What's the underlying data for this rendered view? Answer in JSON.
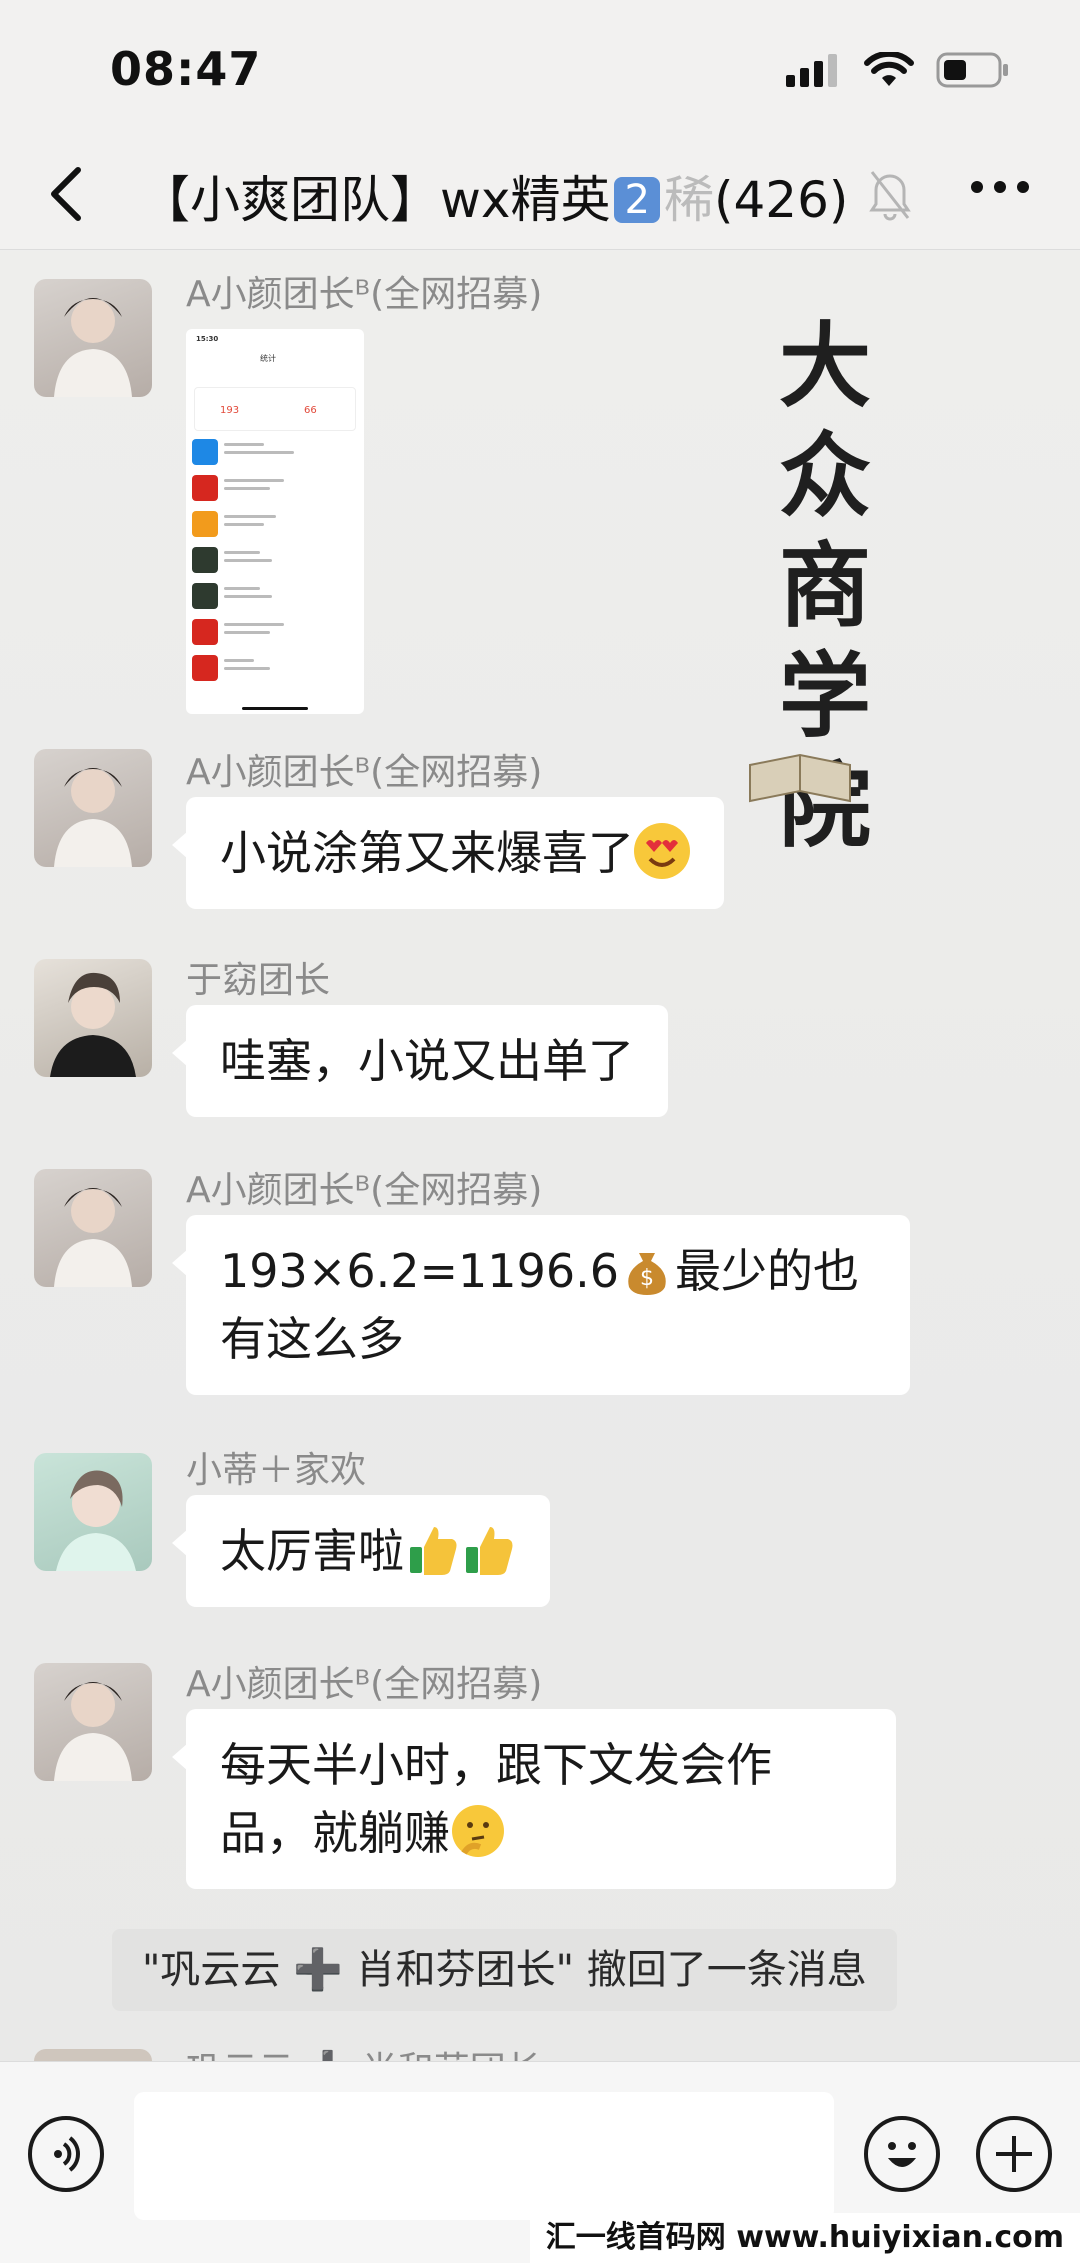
{
  "status_bar": {
    "time": "08:47"
  },
  "nav": {
    "title_prefix": "【小爽团队】wx精英",
    "title_badge": "2",
    "title_cut": "稀",
    "member_count": "(426)"
  },
  "watermark": {
    "chars": [
      "大",
      "众",
      "商",
      "学",
      "院"
    ]
  },
  "messages": [
    {
      "sender": "A小颜团长ᴮ(全网招募)",
      "type": "image"
    },
    {
      "sender": "A小颜团长ᴮ(全网招募)",
      "text": "小说涂第又来爆喜了",
      "emoji": "heart-eyes-emoji"
    },
    {
      "sender": "于窈团长",
      "text": "哇塞，小说又出单了"
    },
    {
      "sender": "A小颜团长ᴮ(全网招募)",
      "text_line1": "193×6.2=1196.6",
      "text_line1_tail": "最少的也",
      "text_line2": "有这么多",
      "emoji": "money-bag-emoji"
    },
    {
      "sender": "小蒂＋家欢",
      "text": "太厉害啦",
      "emoji": "thumbs-up-emoji"
    },
    {
      "sender": "A小颜团长ᴮ(全网招募)",
      "text_line1": "每天半小时，跟下文发会作",
      "text_line2": "品，就躺赚",
      "emoji": "thinking-emoji"
    }
  ],
  "system_note": "\"巩云云 ➕ 肖和芬团长\" 撤回了一条消息",
  "next_sender": "巩云云 ➕ 肖和芬团长",
  "screenshot": {
    "time": "15:30",
    "title": "统计",
    "stat_a": "193",
    "stat_b": "66",
    "apps": [
      "知乎",
      "盐言",
      "悟空",
      "书旗",
      "书旗",
      "盐言",
      "盐言"
    ]
  },
  "colors": {
    "accent_blue": "#5b8fd6",
    "bubble": "#ffffff",
    "background": "#eeeeed"
  },
  "icons": {
    "back": "chevron-left-icon",
    "mute": "bell-off-icon",
    "more": "more-icon",
    "voice": "voice-icon",
    "emoji": "smile-icon",
    "plus": "plus-icon"
  },
  "site_tag": "汇一线首码网 www.huiyixian.com"
}
